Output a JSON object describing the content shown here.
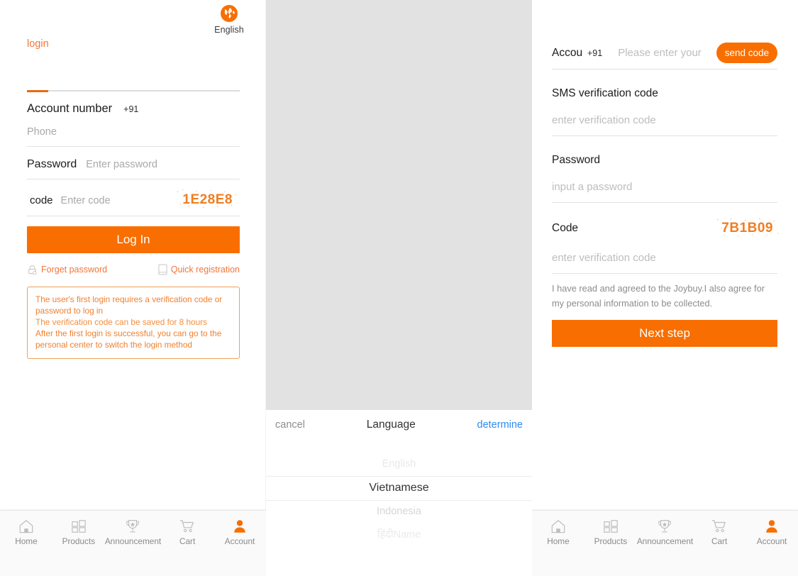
{
  "accent": "#f96e00",
  "accent_text": "#f2763a",
  "link_blue": "#2d8cf0",
  "dim_gray": "#e2e2e2",
  "lang": {
    "icon": "globe-icon",
    "label": "English"
  },
  "login": {
    "title": "login",
    "account_label": "Account number",
    "country_code": "+91",
    "phone_placeholder": "Phone",
    "password_label": "Password",
    "password_placeholder": "Enter password",
    "code_label": "code",
    "code_placeholder": "Enter code",
    "captcha": "1E28E8",
    "submit_label": "Log In",
    "forget_label": "Forget password",
    "register_label": "Quick registration",
    "note_lines": [
      "The user's first login requires a verification code or password to log in",
      "The verification code can be saved for 8 hours",
      "After the first login is successful, you can go to the personal center to switch the login method"
    ]
  },
  "picker": {
    "cancel": "cancel",
    "title": "Language",
    "determine": "determine",
    "options": [
      "English",
      "Vietnamese",
      "Indonesia",
      "हिंदीName"
    ],
    "selected": "Vietnamese"
  },
  "register": {
    "account_label": "Accou",
    "country_code": "+91",
    "phone_placeholder": "Please enter your",
    "send_code_label": "send code",
    "sms_label": "SMS verification code",
    "sms_placeholder": "enter verification code",
    "password_label": "Password",
    "password_placeholder": "input a password",
    "code_label": "Code",
    "captcha": "7B1B09",
    "code_placeholder": "enter verification code",
    "agreement": "I have read and agreed to the Joybuy.I also agree for my personal information to be collected.",
    "next_label": "Next step"
  },
  "tabbar": {
    "items": [
      {
        "icon": "home-icon",
        "label": "Home"
      },
      {
        "icon": "grid-icon",
        "label": "Products"
      },
      {
        "icon": "trophy-icon",
        "label": "Announcement"
      },
      {
        "icon": "cart-icon",
        "label": "Cart"
      },
      {
        "icon": "person-icon",
        "label": "Account"
      }
    ]
  }
}
